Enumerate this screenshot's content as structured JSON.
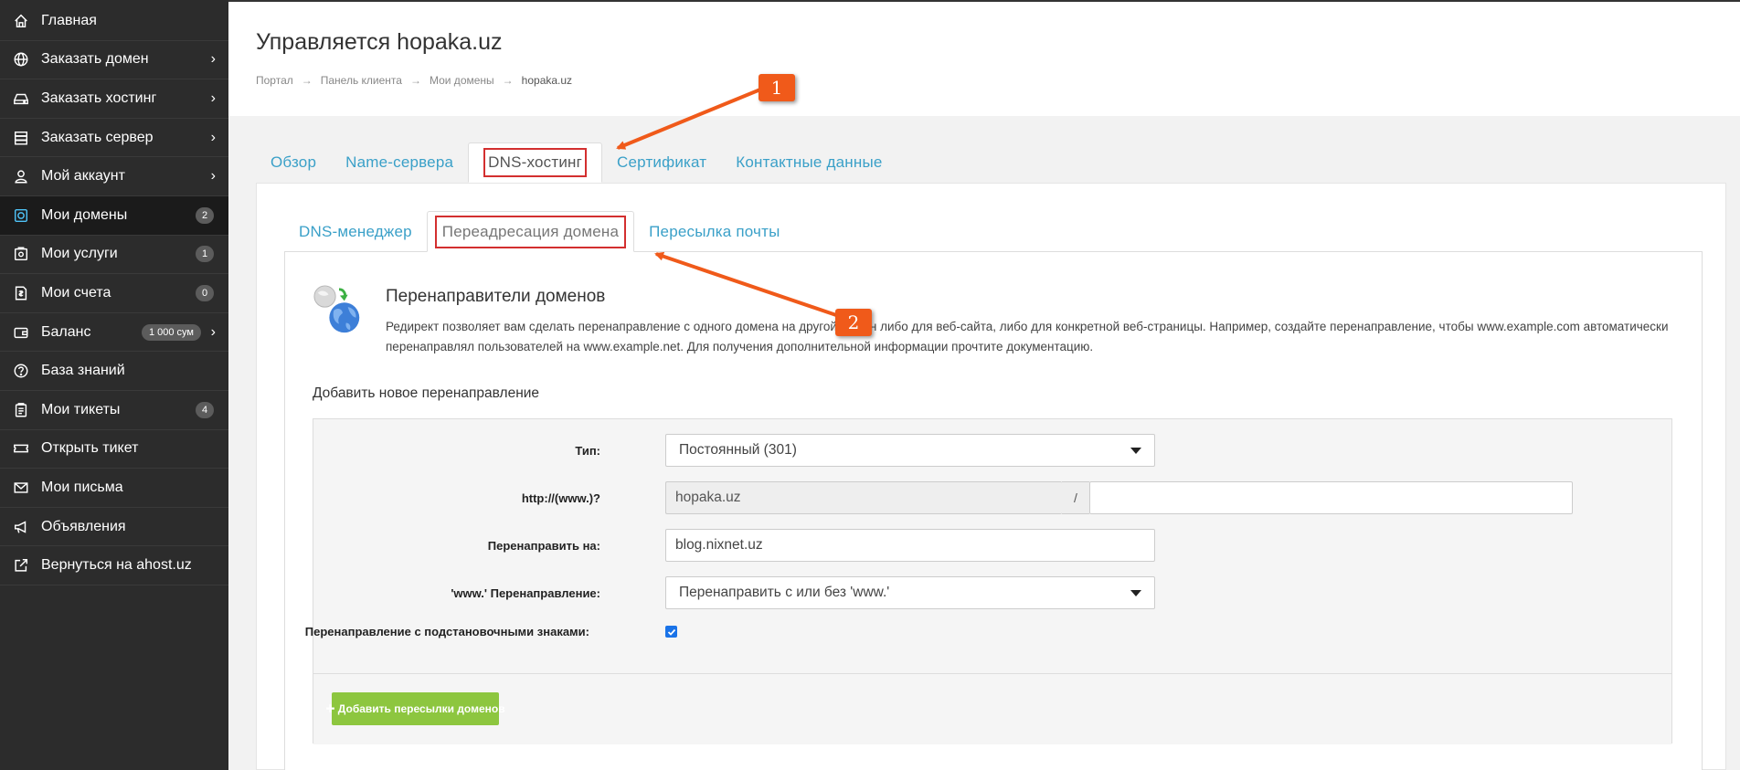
{
  "sidebar": {
    "items": [
      {
        "label": "Главная",
        "icon": "home-icon"
      },
      {
        "label": "Заказать домен",
        "icon": "globe-icon"
      },
      {
        "label": "Заказать хостинг",
        "icon": "hdd-icon"
      },
      {
        "label": "Заказать сервер",
        "icon": "server-icon"
      },
      {
        "label": "Мой аккаунт",
        "icon": "user-icon"
      },
      {
        "label": "Мои домены",
        "icon": "domain-icon",
        "badge": "2"
      },
      {
        "label": "Мои услуги",
        "icon": "services-icon",
        "badge": "1"
      },
      {
        "label": "Мои счета",
        "icon": "invoice-icon",
        "badge": "0"
      },
      {
        "label": "Баланс",
        "icon": "wallet-icon",
        "badge": "1 000 сум"
      },
      {
        "label": "База знаний",
        "icon": "help-icon"
      },
      {
        "label": "Мои тикеты",
        "icon": "ticket-icon",
        "badge": "4"
      },
      {
        "label": "Открыть тикет",
        "icon": "open-ticket-icon"
      },
      {
        "label": "Мои письма",
        "icon": "mail-icon"
      },
      {
        "label": "Объявления",
        "icon": "megaphone-icon"
      },
      {
        "label": "Вернуться на ahost.uz",
        "icon": "external-link-icon"
      }
    ]
  },
  "header": {
    "title": "Управляется hopaka.uz",
    "breadcrumb": [
      "Портал",
      "Панель клиента",
      "Мои домены",
      "hopaka.uz"
    ],
    "breadcrumb_sep": "→"
  },
  "main_tabs": [
    "Обзор",
    "Name-сервера",
    "DNS-хостинг",
    "Сертификат",
    "Контактные данные"
  ],
  "sub_tabs": [
    "DNS-менеджер",
    "Переадресация домена",
    "Пересылка почты"
  ],
  "intro": {
    "title": "Перенаправители доменов",
    "text": "Редирект позволяет вам сделать перенаправление с одного домена на другой домен либо для веб-сайта, либо для конкретной веб-страницы. Например, создайте перенаправление, чтобы www.example.com автоматически перенаправлял пользователей на www.example.net. Для получения дополнительной информации прочтите документацию."
  },
  "form": {
    "section_title": "Добавить новое перенаправление",
    "type_label": "Тип:",
    "type_value": "Постоянный (301)",
    "source_label": "http://(www.)?",
    "source_domain": "hopaka.uz",
    "source_sep": "/",
    "source_path": "",
    "target_label": "Перенаправить на:",
    "target_value": "blog.nixnet.uz",
    "www_label": "'www.' Перенаправление:",
    "www_value": "Перенаправить с или без 'www.'",
    "wildcard_label": "Перенаправление с подстановочными знаками:",
    "wildcard_checked": true,
    "submit_label": "✚ Добавить пересылки доменов"
  },
  "annotations": [
    "1",
    "2"
  ],
  "colors": {
    "accent": "#3aa0c8",
    "highlight": "#d32f2f",
    "annotation": "#f05a1a",
    "button": "#8dc63f",
    "sidebar": "#2c2c2c"
  }
}
